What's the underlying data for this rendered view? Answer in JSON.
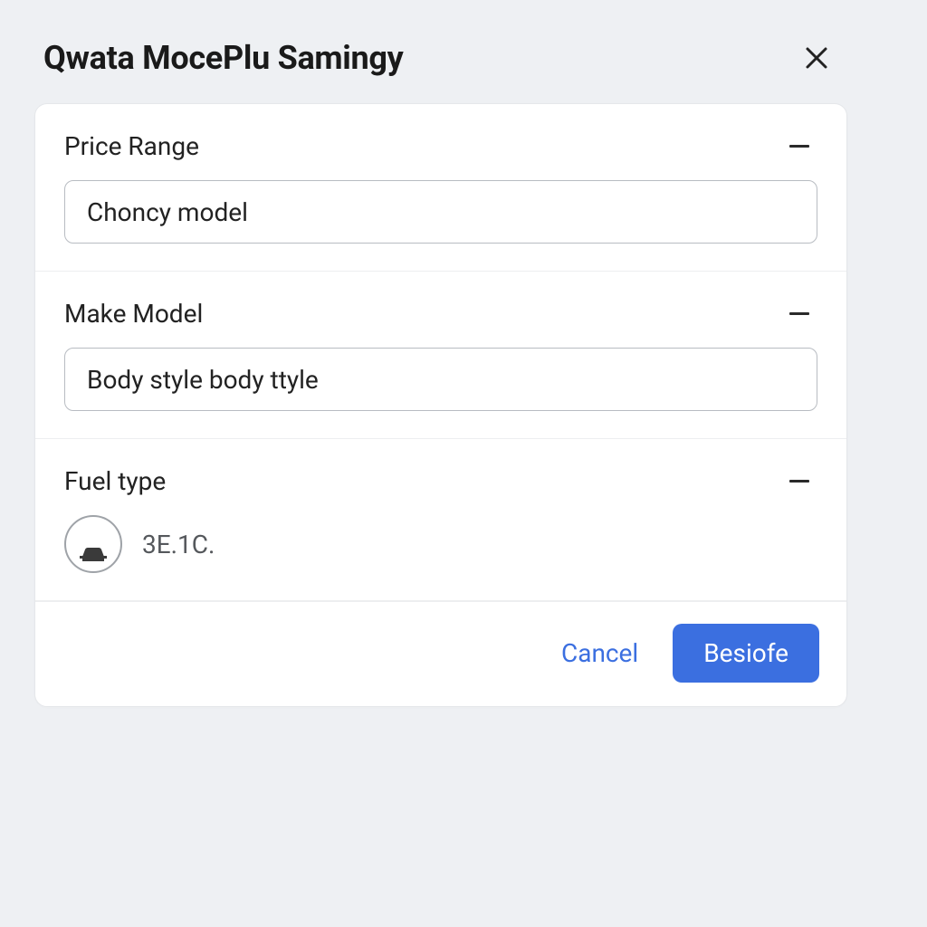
{
  "modal": {
    "title": "Qwata MocePlu Samingy",
    "close_icon": "close-icon"
  },
  "sections": {
    "price_range": {
      "title": "Price Range",
      "input_value": "Choncy model"
    },
    "make_model": {
      "title": "Make Model",
      "input_value": "Body style body ttyle"
    },
    "fuel_type": {
      "title": "Fuel type",
      "icon": "car-icon",
      "value": "3E.1C."
    }
  },
  "footer": {
    "cancel_label": "Cancel",
    "primary_label": "Besiofe"
  }
}
